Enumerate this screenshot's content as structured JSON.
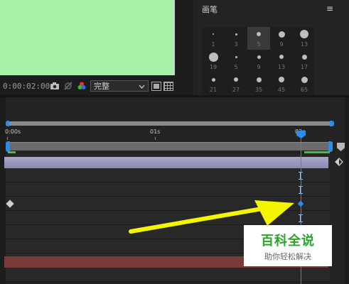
{
  "viewer": {
    "timecode": "0:00:02:00",
    "resolution": "完整"
  },
  "brush_panel": {
    "title": "画笔",
    "menu_glyph": "≡",
    "brushes": [
      {
        "size": "1",
        "dot": 2,
        "selected": false
      },
      {
        "size": "3",
        "dot": 3,
        "selected": false
      },
      {
        "size": "5",
        "dot": 6,
        "selected": true
      },
      {
        "size": "9",
        "dot": 9,
        "selected": false
      },
      {
        "size": "13",
        "dot": 12,
        "selected": false
      },
      {
        "size": "19",
        "dot": 13,
        "selected": false
      },
      {
        "size": "5",
        "dot": 3,
        "selected": false
      },
      {
        "size": "9",
        "dot": 5,
        "selected": false
      },
      {
        "size": "13",
        "dot": 6,
        "selected": false
      },
      {
        "size": "17",
        "dot": 7,
        "selected": false
      },
      {
        "size": "21",
        "dot": 5,
        "selected": false
      },
      {
        "size": "27",
        "dot": 6,
        "selected": false
      },
      {
        "size": "35",
        "dot": 7,
        "selected": false
      },
      {
        "size": "45",
        "dot": 8,
        "selected": false
      },
      {
        "size": "65",
        "dot": 9,
        "selected": false
      }
    ]
  },
  "timeline": {
    "ruler_labels": [
      "0:00s",
      "01s",
      "02s"
    ]
  },
  "watermark": {
    "title": "百科全说",
    "subtitle": "助你轻松解决"
  },
  "colors": {
    "comp_background": "#a5f2a7",
    "playhead": "#2d8ceb",
    "arrow": "#f5f500",
    "watermark_green": "#2aa52a"
  }
}
